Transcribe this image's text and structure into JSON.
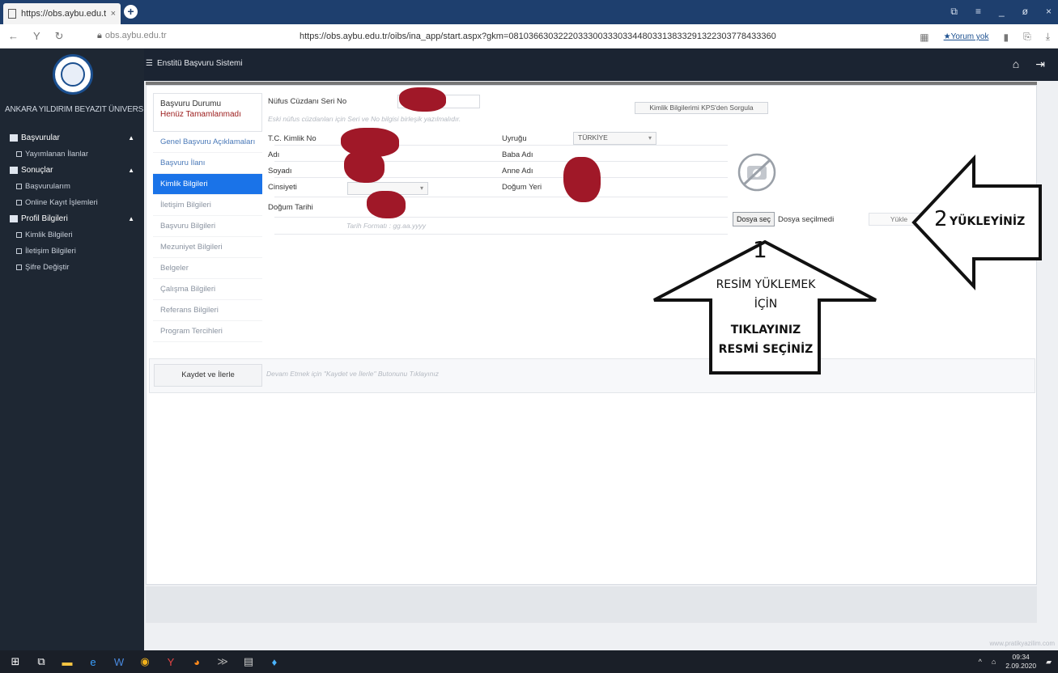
{
  "browser": {
    "tab_title": "https://obs.aybu.edu.tr/",
    "tab_close": "×",
    "new_tab": "+",
    "domain": "obs.aybu.edu.tr",
    "url": "https://obs.aybu.edu.tr/oibs/ina_app/start.aspx?gkm=081036630322203330033303344803313833291322303778433360",
    "yorum_label": "★Yorum yok",
    "window_controls": [
      "⧉",
      "≡",
      "_",
      "ø",
      "×"
    ]
  },
  "app": {
    "system_title": "Enstitü Başvuru Sistemi",
    "university": "ANKARA YILDIRIM BEYAZIT ÜNIVERSITESI"
  },
  "sidebar": {
    "groups": [
      {
        "label": "Başvurular",
        "items": [
          "Yayımlanan İlanlar"
        ]
      },
      {
        "label": "Sonuçlar",
        "items": [
          "Başvurularım",
          "Online Kayıt İşlemleri"
        ]
      },
      {
        "label": "Profil Bilgileri",
        "items": [
          "Kimlik Bilgileri",
          "İletişim Bilgileri",
          "Şifre Değiştir"
        ]
      }
    ]
  },
  "steps": {
    "status_title": "Başvuru Durumu",
    "status_value": "Henüz Tamamlanmadı",
    "items": [
      "Genel Başvuru Açıklamaları",
      "Başvuru İlanı",
      "Kimlik Bilgileri",
      "İletişim Bilgileri",
      "Başvuru Bilgileri",
      "Mezuniyet Bilgileri",
      "Belgeler",
      "Çalışma Bilgileri",
      "Referans Bilgileri",
      "Program Tercihleri"
    ],
    "active_index": 2
  },
  "form": {
    "nufus_label": "Nüfus Cüzdanı Seri No",
    "nufus_help": "Eski nüfus cüzdanları için Seri ve No bilgisi birleşik yazılmalıdır.",
    "kps_button": "Kimlik Bilgilerimi KPS'den Sorgula",
    "tc_label": "T.C. Kimlik No",
    "ad_label": "Adı",
    "soyad_label": "Soyadı",
    "cinsiyet_label": "Cinsiyeti",
    "dogum_tarihi_label": "Doğum Tarihi",
    "tarih_help": "Tarih Formatı : gg.aa.yyyy",
    "uyruk_label": "Uyruğu",
    "uyruk_value": "TÜRKİYE",
    "baba_label": "Baba Adı",
    "anne_label": "Anne Adı",
    "dogum_yeri_label": "Doğum Yeri",
    "file_button": "Dosya seç",
    "file_status": "Dosya seçilmedi",
    "upload_button": "Yükle",
    "save_button": "Kaydet ve İlerle",
    "save_hint": "Devam Etmek için \"Kaydet ve İlerle\" Butonunu Tıklayınız"
  },
  "annotations": {
    "arrow1_number": "1",
    "arrow1_lines": [
      "RESİM YÜKLEMEK",
      "İÇİN",
      "TIKLAYINIZ",
      "RESMİ SEÇİNİZ"
    ],
    "arrow2_number": "2",
    "arrow2_text": "YÜKLEYİNİZ"
  },
  "footer": {
    "watermark": "www.pratikyazilim.com"
  },
  "taskbar": {
    "time": "09:34",
    "date": "2.09.2020",
    "tray": "^"
  }
}
